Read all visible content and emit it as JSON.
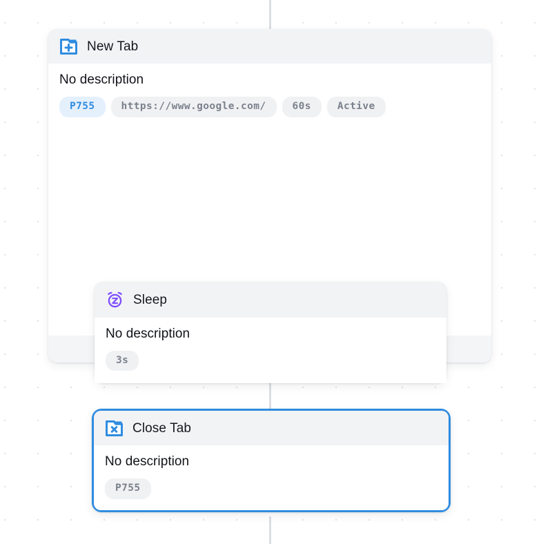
{
  "canvas": {
    "grid_dot_color": "#dfe1e6",
    "edge_color": "#dcdee3",
    "background": "#ffffff"
  },
  "colors": {
    "accent_blue": "#2f8ce0",
    "icon_blue": "#2f8ce0",
    "icon_purple": "#7c4dff",
    "header_gray": "#f2f3f5",
    "tag_gray_bg": "#f0f1f3",
    "tag_gray_text": "#7b818c",
    "tag_blue_bg": "#e5f0fd",
    "tag_blue_text": "#2f8ce0",
    "selection_border": "#2f8ce0"
  },
  "nodes": {
    "new_tab": {
      "icon": "new-tab-icon",
      "title": "New Tab",
      "description": "No description",
      "tags": [
        {
          "label": "P755",
          "style": "accent"
        },
        {
          "label": "https://www.google.com/",
          "style": "default"
        },
        {
          "label": "60s",
          "style": "default"
        },
        {
          "label": "Active",
          "style": "default"
        }
      ],
      "collapse_icon": "chevrons-up-icon",
      "selected": false
    },
    "sleep": {
      "icon": "alarm-sleep-icon",
      "title": "Sleep",
      "description": "No description",
      "tags": [
        {
          "label": "3s",
          "style": "default"
        }
      ],
      "selected": false
    },
    "close_tab": {
      "icon": "close-tab-icon",
      "title": "Close Tab",
      "description": "No description",
      "tags": [
        {
          "label": "P755",
          "style": "default"
        }
      ],
      "selected": true
    }
  }
}
